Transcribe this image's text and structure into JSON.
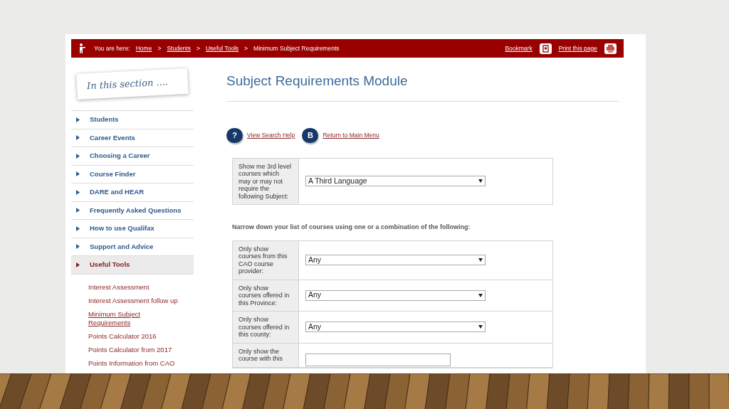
{
  "breadcrumb": {
    "label": "You are here:",
    "items": [
      {
        "text": "Home",
        "kind": "link"
      },
      {
        "text": ">",
        "kind": "separator"
      },
      {
        "text": "Students",
        "kind": "link"
      },
      {
        "text": ">",
        "kind": "separator"
      },
      {
        "text": "Useful Tools",
        "kind": "link"
      },
      {
        "text": ">",
        "kind": "separator"
      },
      {
        "text": "Minimum Subject Requirements",
        "kind": "current"
      }
    ]
  },
  "actions": [
    {
      "label": "Bookmark",
      "kind": "bookmark"
    },
    {
      "label": "Print this page",
      "kind": "print"
    }
  ],
  "sidebar": {
    "heading": "In this section ....",
    "items": [
      {
        "label": "Students",
        "selected": false
      },
      {
        "label": "Career Events",
        "selected": false
      },
      {
        "label": "Choosing a Career",
        "selected": false
      },
      {
        "label": "Course Finder",
        "selected": false
      },
      {
        "label": "DARE and HEAR",
        "selected": false
      },
      {
        "label": "Frequently Asked Questions",
        "selected": false
      },
      {
        "label": "How to use Qualifax",
        "selected": false
      },
      {
        "label": "Support and Advice",
        "selected": false
      },
      {
        "label": "Useful Tools",
        "selected": true
      }
    ],
    "sub_items": [
      {
        "label": "Interest Assessment",
        "selected": false
      },
      {
        "label": "Interest Assessment follow up",
        "selected": false
      },
      {
        "label": "Minimum Subject Requirements",
        "selected": true
      },
      {
        "label": "Points Calculator 2016",
        "selected": false
      },
      {
        "label": "Points Calculator from 2017",
        "selected": false
      },
      {
        "label": "Points Information from CAO",
        "selected": false
      }
    ]
  },
  "main": {
    "title": "Subject Requirements Module",
    "links": [
      {
        "badge": "?",
        "label": "View Search Help"
      },
      {
        "badge": "B",
        "label": "Return to Main Menu"
      }
    ],
    "subject_filter": {
      "label": "Show me 3rd level courses which may or may not require the following Subject:",
      "value": "A Third Language"
    },
    "narrow_text": "Narrow down your list of courses using one or a combination of the following:",
    "filters": [
      {
        "label": "Only show courses from this CAO course provider:",
        "kind": "select",
        "value": "Any"
      },
      {
        "label": "Only show courses offered in this Province:",
        "kind": "select",
        "value": "Any"
      },
      {
        "label": "Only show courses offered in this county:",
        "kind": "select",
        "value": "Any"
      },
      {
        "label": "Only show the course with this",
        "kind": "text"
      }
    ]
  }
}
